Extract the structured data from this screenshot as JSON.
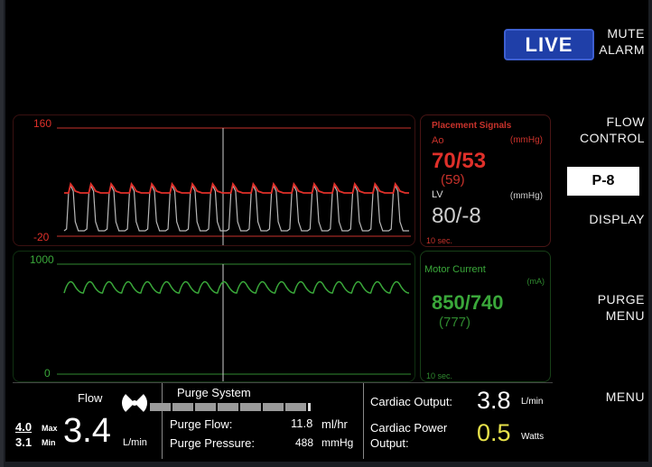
{
  "menu": {
    "mute_alarm": [
      "MUTE",
      "ALARM"
    ],
    "flow_control": [
      "FLOW",
      "CONTROL"
    ],
    "p_level": "P-8",
    "display": "DISPLAY",
    "purge_menu": [
      "PURGE",
      "MENU"
    ],
    "menu": "MENU"
  },
  "live_label": "LIVE",
  "waveform_pressure": {
    "max_label": "160",
    "min_label": "-20",
    "color_ao": "#e0302a",
    "color_lv": "#b8b8b8"
  },
  "waveform_current": {
    "max_label": "1000",
    "min_label": "0",
    "color": "#3aa83a"
  },
  "placement_signals": {
    "title": "Placement Signals",
    "ao_label": "Ao",
    "ao_unit": "(mmHg)",
    "ao_value": "70/53",
    "ao_mean": "(59)",
    "lv_label": "LV",
    "lv_unit": "(mmHg)",
    "lv_value": "80/-8",
    "time_scale": "10 sec."
  },
  "motor_current": {
    "title": "Motor Current",
    "unit": "(mA)",
    "value": "850/740",
    "mean": "(777)",
    "time_scale": "10 sec."
  },
  "status": {
    "flow_label": "Flow",
    "flow_max": "4.0",
    "flow_max_label": "Max",
    "flow_min": "3.1",
    "flow_min_label": "Min",
    "flow_value": "3.4",
    "flow_unit": "L/min",
    "purge_system_label": "Purge System",
    "purge_flow_label": "Purge Flow:",
    "purge_flow_value": "11.8",
    "purge_flow_unit": "ml/hr",
    "purge_pressure_label": "Purge Pressure:",
    "purge_pressure_value": "488",
    "purge_pressure_unit": "mmHg",
    "cardiac_output_label": "Cardiac Output:",
    "cardiac_output_value": "3.8",
    "cardiac_output_unit": "L/min",
    "cardiac_power_label_1": "Cardiac Power",
    "cardiac_power_label_2": "Output:",
    "cardiac_power_value": "0.5",
    "cardiac_power_unit": "Watts",
    "cardiac_power_color": "#e6e14a"
  }
}
